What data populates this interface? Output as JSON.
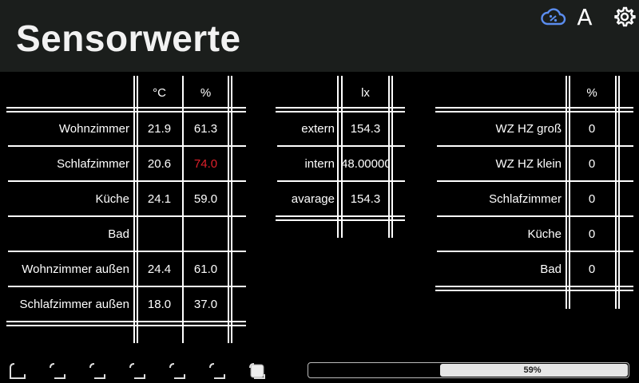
{
  "header": {
    "title": "Sensorwerte",
    "icons": [
      "cloud-sync-icon",
      "font-a-icon",
      "settings-gear-icon"
    ],
    "font_icon_label": "A",
    "accent_color": "#5b8def"
  },
  "climate_table": {
    "headers": [
      "",
      "°C",
      "%"
    ],
    "rows": [
      {
        "name": "Wohnzimmer",
        "temp": "21.9",
        "hum": "61.3"
      },
      {
        "name": "Schlafzimmer",
        "temp": "20.6",
        "hum": "74.0",
        "hum_alert": true
      },
      {
        "name": "Küche",
        "temp": "24.1",
        "hum": "59.0"
      },
      {
        "name": "Bad",
        "temp": "",
        "hum": ""
      },
      {
        "name": "Wohnzimmer außen",
        "temp": "24.4",
        "hum": "61.0"
      },
      {
        "name": "Schlafzimmer außen",
        "temp": "18.0",
        "hum": "37.0"
      }
    ],
    "alert_color": "#e0202a"
  },
  "light_table": {
    "headers": [
      "",
      "lx"
    ],
    "rows": [
      {
        "name": "extern",
        "value": "154.3"
      },
      {
        "name": "intern",
        "value": "48.000000"
      },
      {
        "name": "avarage",
        "value": "154.3"
      }
    ]
  },
  "heating_table": {
    "headers": [
      "",
      "%"
    ],
    "rows": [
      {
        "name": "WZ HZ groß",
        "value": "0"
      },
      {
        "name": "WZ HZ klein",
        "value": "0"
      },
      {
        "name": "Schlafzimmer",
        "value": "0"
      },
      {
        "name": "Küche",
        "value": "0"
      },
      {
        "name": "Bad",
        "value": "0"
      }
    ]
  },
  "footer": {
    "page_indicators": 7,
    "active_page": 7,
    "progress_label": "59%",
    "progress_value": 0.59
  }
}
